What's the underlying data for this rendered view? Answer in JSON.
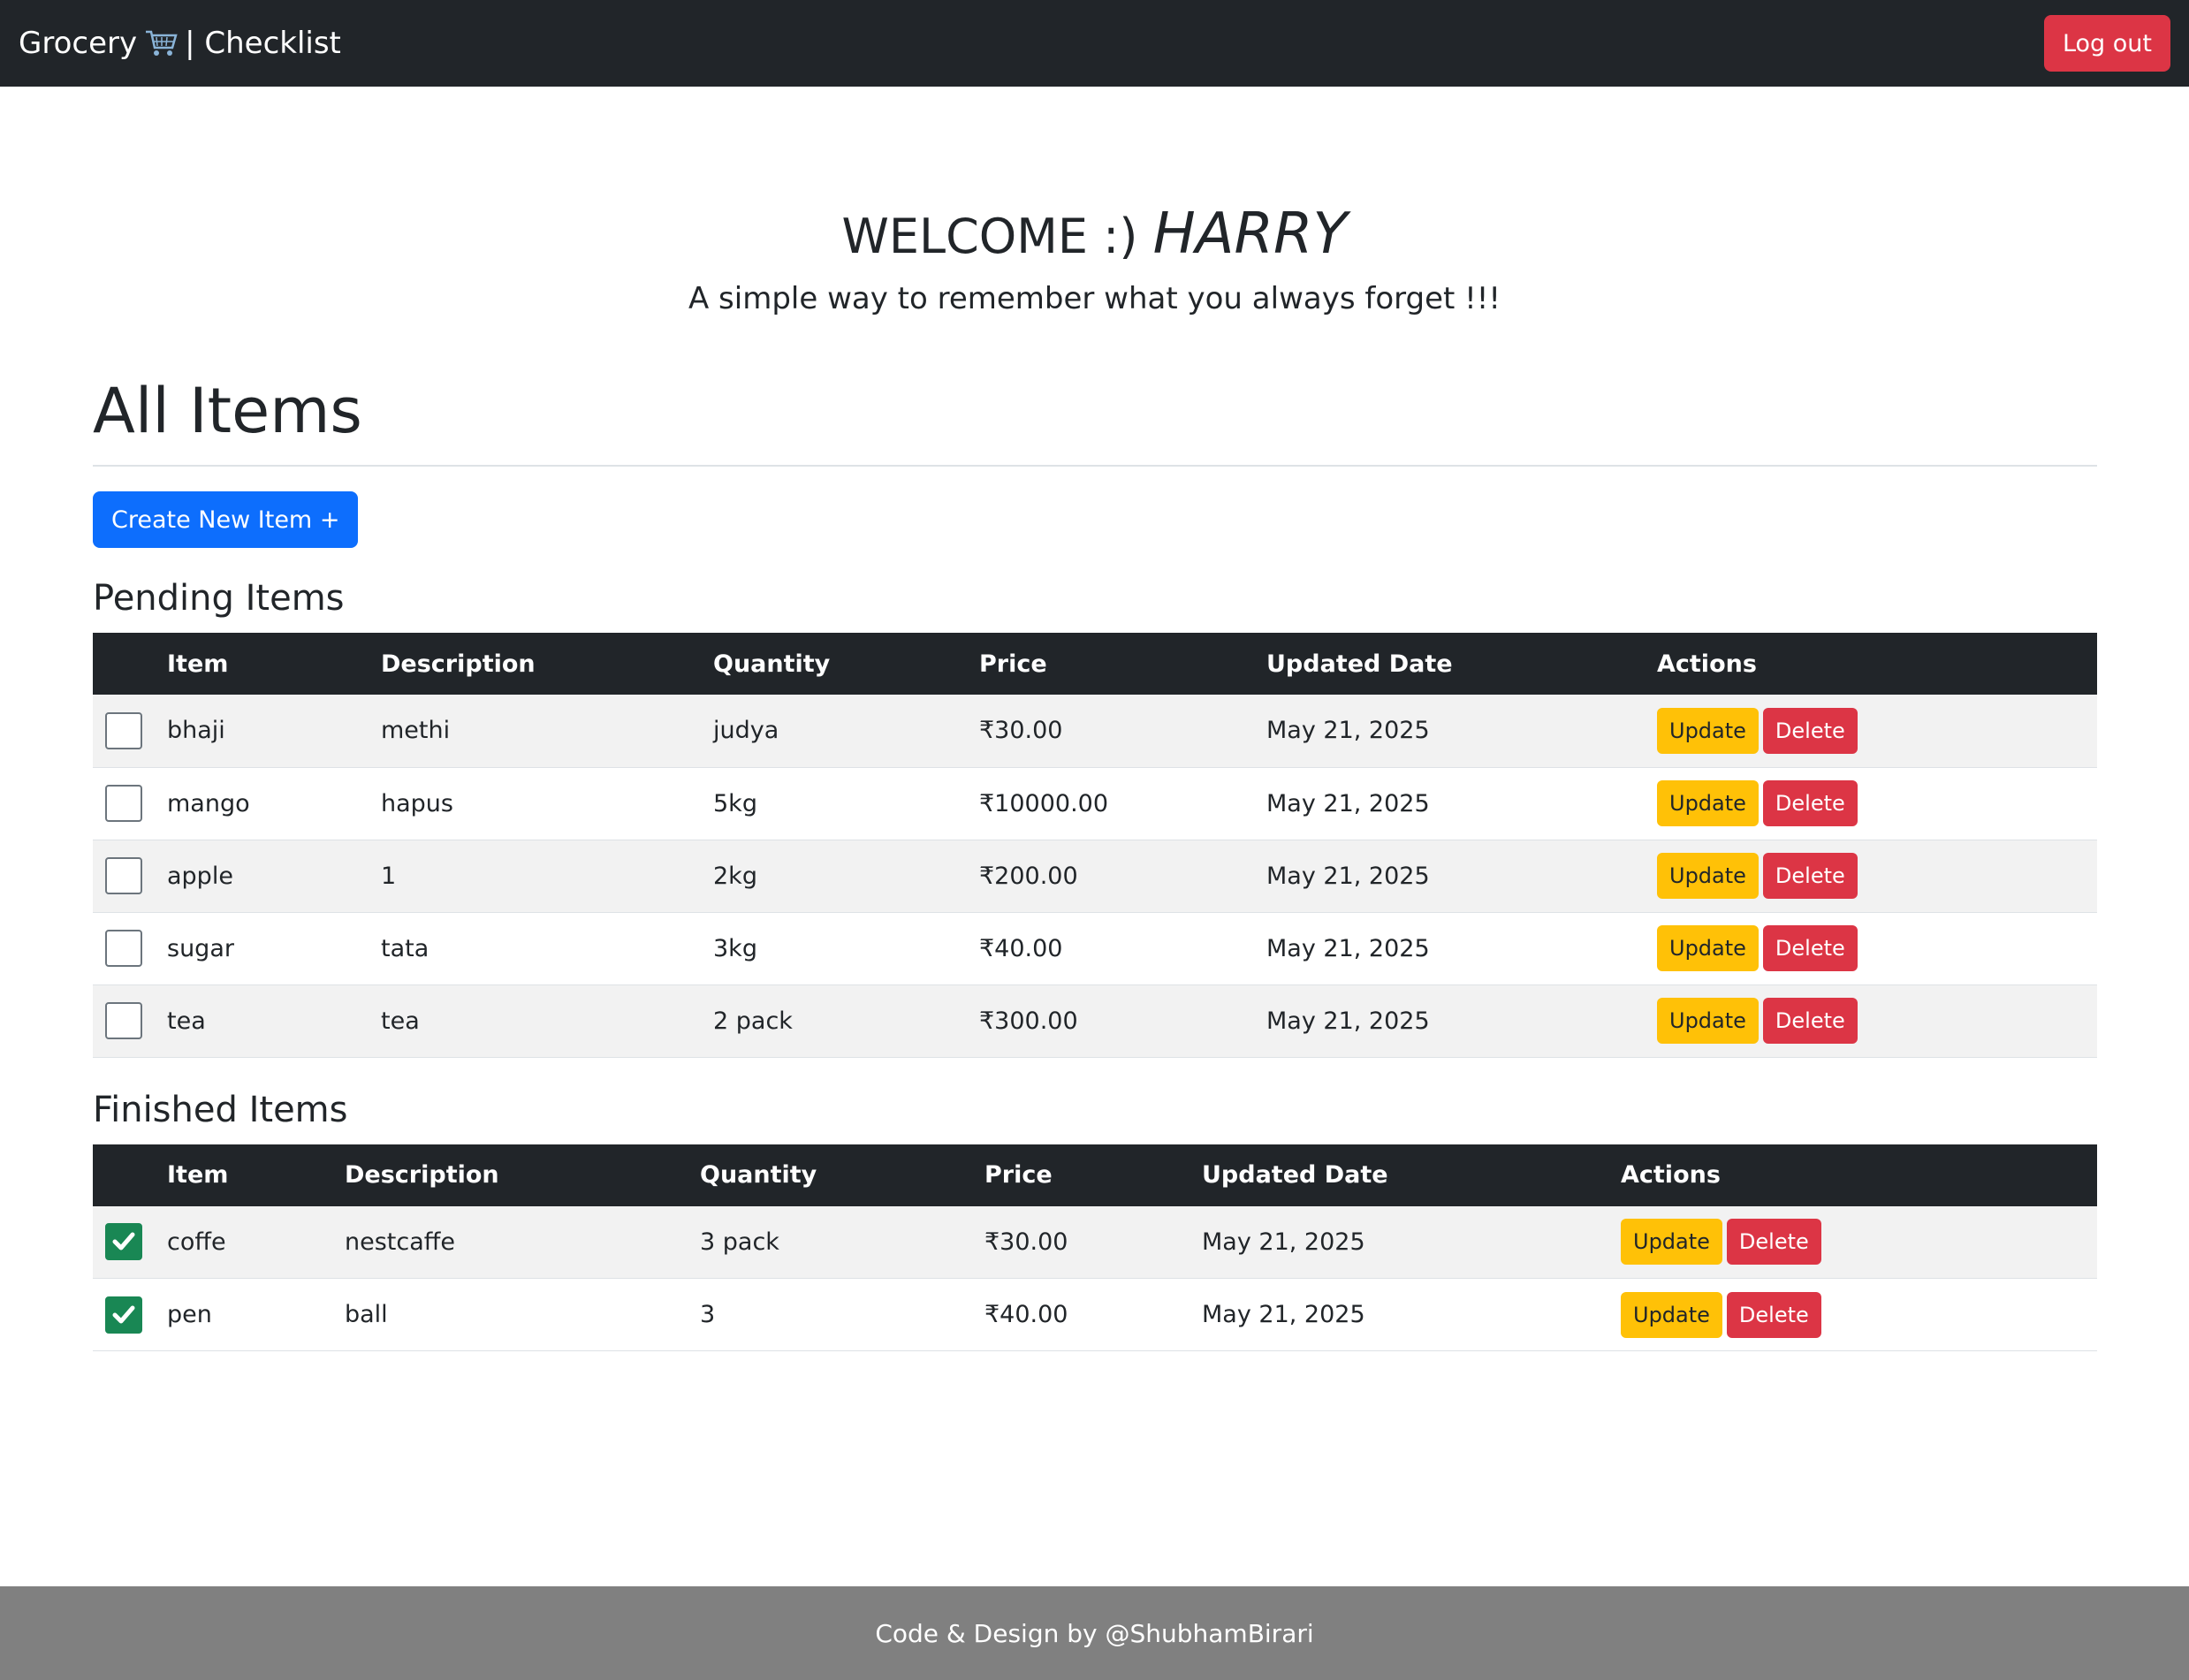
{
  "navbar": {
    "brand_text": "Grocery",
    "brand_suffix": "| Checklist",
    "cart_icon": "shopping-cart-icon",
    "logout_label": "Log out"
  },
  "hero": {
    "welcome_prefix": "WELCOME :)",
    "user_name": "HARRY",
    "tagline": "A simple way to remember what you always forget !!!"
  },
  "main": {
    "title": "All Items",
    "create_label": "Create New Item +",
    "pending_title": "Pending Items",
    "finished_title": "Finished Items",
    "columns": [
      "Item",
      "Description",
      "Quantity",
      "Price",
      "Updated Date",
      "Actions"
    ],
    "update_label": "Update",
    "delete_label": "Delete",
    "pending": [
      {
        "item": "bhaji",
        "description": "methi",
        "quantity": "judya",
        "price": "₹30.00",
        "date": "May 21, 2025",
        "checked": false
      },
      {
        "item": "mango",
        "description": "hapus",
        "quantity": "5kg",
        "price": "₹10000.00",
        "date": "May 21, 2025",
        "checked": false
      },
      {
        "item": "apple",
        "description": "1",
        "quantity": "2kg",
        "price": "₹200.00",
        "date": "May 21, 2025",
        "checked": false
      },
      {
        "item": "sugar",
        "description": "tata",
        "quantity": "3kg",
        "price": "₹40.00",
        "date": "May 21, 2025",
        "checked": false
      },
      {
        "item": "tea",
        "description": "tea",
        "quantity": "2 pack",
        "price": "₹300.00",
        "date": "May 21, 2025",
        "checked": false
      }
    ],
    "finished": [
      {
        "item": "coffe",
        "description": "nestcaffe",
        "quantity": "3 pack",
        "price": "₹30.00",
        "date": "May 21, 2025",
        "checked": true
      },
      {
        "item": "pen",
        "description": "ball",
        "quantity": "3",
        "price": "₹40.00",
        "date": "May 21, 2025",
        "checked": true
      }
    ]
  },
  "footer": {
    "credit": "Code & Design by @ShubhamBirari"
  },
  "colors": {
    "navbar": "#212529",
    "primary": "#0d6efd",
    "danger": "#dc3545",
    "warning": "#ffc107",
    "success": "#198754",
    "footer": "#808080"
  }
}
